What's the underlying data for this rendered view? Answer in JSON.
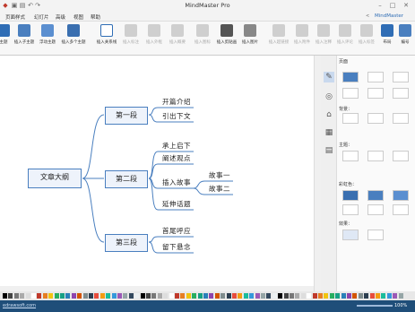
{
  "app": {
    "title": "MindMaster Pro"
  },
  "titlebar": {
    "user_label": "MindMaster"
  },
  "menu": {
    "items": [
      "页面样式",
      "幻灯片",
      "高级",
      "视图",
      "帮助"
    ]
  },
  "ribbon": {
    "buttons": [
      {
        "label": "主题",
        "enabled": true
      },
      {
        "label": "插入子主题",
        "enabled": true
      },
      {
        "label": "浮动主题",
        "enabled": true
      },
      {
        "label": "插入多个主题",
        "enabled": true
      },
      {
        "label": "插入关系线",
        "enabled": true
      },
      {
        "label": "插入标注",
        "enabled": false
      },
      {
        "label": "插入外框",
        "enabled": false
      },
      {
        "label": "插入概要",
        "enabled": false
      },
      {
        "label": "插入图标",
        "enabled": false
      },
      {
        "label": "插入剪贴画",
        "enabled": true
      },
      {
        "label": "插入图片",
        "enabled": true
      },
      {
        "label": "插入超链接",
        "enabled": false
      },
      {
        "label": "插入附件",
        "enabled": false
      },
      {
        "label": "插入注释",
        "enabled": false
      },
      {
        "label": "插入评论",
        "enabled": false
      },
      {
        "label": "插入标签",
        "enabled": false
      },
      {
        "label": "布局",
        "enabled": true
      },
      {
        "label": "编号",
        "enabled": true
      }
    ]
  },
  "mindmap": {
    "root": "文章大纲",
    "topics": [
      {
        "label": "第一段",
        "children": [
          "开篇介绍",
          "引出下文"
        ]
      },
      {
        "label": "第二段",
        "children": [
          "承上启下",
          "阐述观点",
          "插入故事",
          "延伸话题"
        ]
      },
      {
        "label": "第三段",
        "children": [
          "首尾呼应",
          "留下悬念"
        ]
      }
    ],
    "story_children": [
      "故事一",
      "故事二"
    ]
  },
  "panel": {
    "tab_label": "页面",
    "background_label": "背景：",
    "theme_label": "主题：",
    "color_label": "彩虹色：",
    "effect_label": "效果："
  },
  "statusbar": {
    "url": "edrawsoft.com",
    "zoom": "100%"
  },
  "colors": {
    "accent": "#4a7fbf",
    "statusbar": "#1f4e79"
  }
}
